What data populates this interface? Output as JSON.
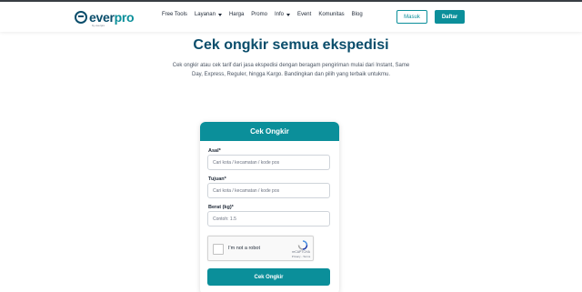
{
  "header": {
    "logo_ever": "ever",
    "logo_pro": "pro",
    "logo_sub": "by everpro",
    "nav": [
      {
        "label": "Free Tools",
        "has_caret": false
      },
      {
        "label": "Layanan",
        "has_caret": true
      },
      {
        "label": "Harga",
        "has_caret": false
      },
      {
        "label": "Promo",
        "has_caret": false
      },
      {
        "label": "Info",
        "has_caret": true
      },
      {
        "label": "Event",
        "has_caret": false
      },
      {
        "label": "Komunitas",
        "has_caret": false
      },
      {
        "label": "Blog",
        "has_caret": false
      }
    ],
    "login_label": "Masuk",
    "register_label": "Daftar"
  },
  "hero": {
    "title": "Cek ongkir semua ekspedisi",
    "description": "Cek ongkir atau cek tarif dari jasa ekspedisi dengan beragam pengiriman mulai dari Instant, Same Day, Express, Reguler, hingga Kargo. Bandingkan dan pilih yang terbaik untukmu."
  },
  "form": {
    "title": "Cek Ongkir",
    "origin_label": "Asal*",
    "origin_placeholder": "Cari kota / kecamatan / kode pos",
    "destination_label": "Tujuan*",
    "destination_placeholder": "Cari kota / kecamatan / kode pos",
    "weight_label": "Berat (kg)*",
    "weight_placeholder": "Contoh: 1.5",
    "recaptcha_text": "I'm not a robot",
    "recaptcha_brand": "reCAPTCHA",
    "recaptcha_links": "Privacy - Terms",
    "submit_label": "Cek Ongkir"
  },
  "colors": {
    "brand": "#0b8f9a",
    "brand_dark": "#0a4d6b"
  }
}
